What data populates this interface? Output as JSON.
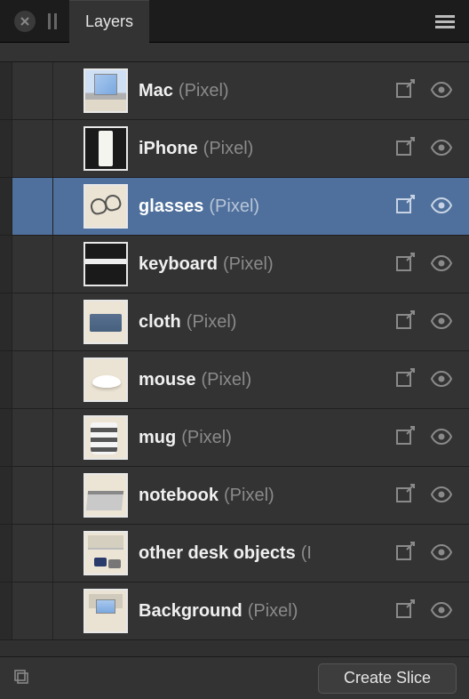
{
  "header": {
    "tab_title": "Layers"
  },
  "layers": [
    {
      "name": "Mac",
      "type": "(Pixel)",
      "selected": false,
      "thumb": "th-mac"
    },
    {
      "name": "iPhone",
      "type": "(Pixel)",
      "selected": false,
      "thumb": "th-iphone"
    },
    {
      "name": "glasses",
      "type": "(Pixel)",
      "selected": true,
      "thumb": "th-glasses"
    },
    {
      "name": "keyboard",
      "type": "(Pixel)",
      "selected": false,
      "thumb": "th-keyboard"
    },
    {
      "name": "cloth",
      "type": "(Pixel)",
      "selected": false,
      "thumb": "th-cloth"
    },
    {
      "name": "mouse",
      "type": "(Pixel)",
      "selected": false,
      "thumb": "th-mouse"
    },
    {
      "name": "mug",
      "type": "(Pixel)",
      "selected": false,
      "thumb": "th-mug"
    },
    {
      "name": "notebook",
      "type": "(Pixel)",
      "selected": false,
      "thumb": "th-notebook"
    },
    {
      "name": "other desk objects",
      "type": "(Pixel)",
      "type_truncated": "(I",
      "selected": false,
      "thumb": "th-other"
    },
    {
      "name": "Background",
      "type": "(Pixel)",
      "selected": false,
      "thumb": "th-bg"
    }
  ],
  "footer": {
    "create_slice_label": "Create Slice"
  }
}
